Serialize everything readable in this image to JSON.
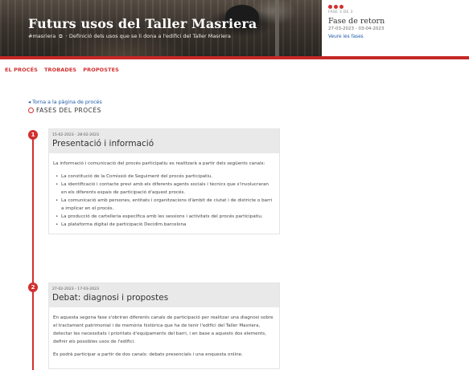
{
  "header": {
    "title": "Futurs usos del Taller Masriera",
    "hashtag": "#masriera",
    "external_icon": "external-link-icon",
    "separator": "·",
    "subtitle": "Definició dels usos que se li dona a l'edifici del Taller Masriera"
  },
  "phase": {
    "step": "FASE 3 DE 3",
    "name": "Fase de retorn",
    "dates": "27-03-2023 - 03-04-2023",
    "link": "Veure les fases",
    "accent": "#d32f2f"
  },
  "tabs": [
    "EL PROCÉS",
    "TROBADES",
    "PROPOSTES"
  ],
  "back_link": "◂ Torna a la pàgina de procés",
  "phases_title": "FASES DEL PROCÉS",
  "phases": [
    {
      "number": "1",
      "dates": "15-02-2023 - 28-02-2023",
      "title": "Presentació i informació",
      "intro": "La informació i comunicació del procés participatiu es realitzarà a partir dels següents canals:",
      "items": [
        "La constitució de la Comissió de Seguiment del procés participatiu.",
        "La identificació i contacte previ amb els diferents agents socials i tècnics que s'involucraran en els diferents espais de participació d'aquest procés.",
        "La comunicació amb persones, entitats i organitzacions d'àmbit de ciutat i de districte o barri a implicar en el procés.",
        "La producció de cartelleria específica amb les sessions i activitats del procés participatiu.",
        "La plataforma digital de participació Decidim.barcelona"
      ]
    },
    {
      "number": "2",
      "dates": "27-02-2023 - 17-03-2023",
      "title": "Debat: diagnosi i propostes",
      "paragraphs": [
        "En aquesta segona fase s'obriran diferents canals de participació per realitzar una diagnosi sobre el tractament patrimonial i de memòria històrica que ha de tenir l'edifici del Taller Masriera, detectar les necessitats i prioritats d'equipaments del barri, i en base a aquests dos elements, definir els possibles usos de l'edifici.",
        "Es podrà participar a partir de dos canals: debats presencials i una enquesta online."
      ]
    }
  ]
}
